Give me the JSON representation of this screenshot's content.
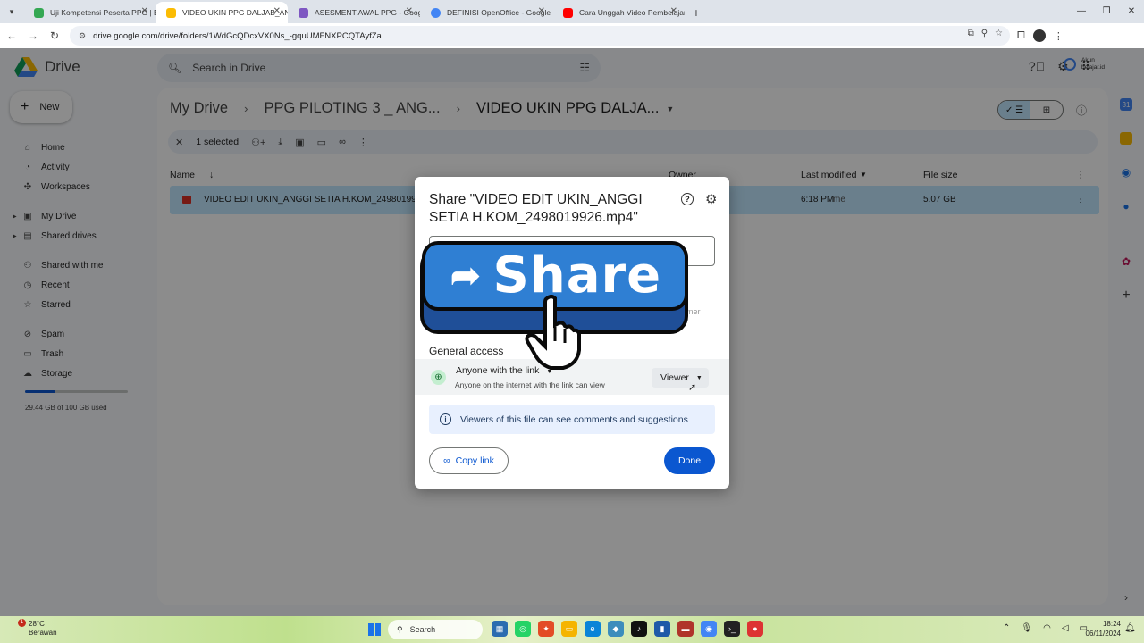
{
  "browser": {
    "tabs": [
      {
        "label": "Uji Kompetensi Peserta PPG | Bi",
        "color": "#34a853",
        "active": false
      },
      {
        "label": "VIDEO UKIN PPG DALJAB_ANGGI",
        "color": "#fbbc04",
        "active": true
      },
      {
        "label": "ASESMENT AWAL PPG - Google",
        "color": "#7e57c2",
        "active": false
      },
      {
        "label": "DEFINISI OpenOffice - Google",
        "color": "#4285f4",
        "active": false
      },
      {
        "label": "Cara Unggah Video Pembelajar",
        "color": "#ff0000",
        "active": false
      }
    ],
    "url": "drive.google.com/drive/folders/1WdGcQDcxVX0Ns_-gquUMFNXPCQTAyfZa"
  },
  "drive": {
    "app_name": "Drive",
    "search_placeholder": "Search in Drive",
    "account_org": "Akun belajar.id",
    "new_label": "New",
    "sidebar": {
      "items": [
        {
          "label": "Home",
          "icon": "home-icon",
          "glyph": "⌂"
        },
        {
          "label": "Activity",
          "icon": "activity-icon",
          "glyph": "⍙"
        },
        {
          "label": "Workspaces",
          "icon": "workspaces-icon",
          "glyph": "✣"
        },
        {
          "label": "My Drive",
          "icon": "my-drive-icon",
          "glyph": "▣"
        },
        {
          "label": "Shared drives",
          "icon": "shared-drives-icon",
          "glyph": "▤"
        },
        {
          "label": "Shared with me",
          "icon": "shared-with-me-icon",
          "glyph": "⚇"
        },
        {
          "label": "Recent",
          "icon": "recent-icon",
          "glyph": "◷"
        },
        {
          "label": "Starred",
          "icon": "star-icon",
          "glyph": "☆"
        },
        {
          "label": "Spam",
          "icon": "spam-icon",
          "glyph": "⊘"
        },
        {
          "label": "Trash",
          "icon": "trash-icon",
          "glyph": "🗑"
        },
        {
          "label": "Storage",
          "icon": "cloud-icon",
          "glyph": "☁"
        }
      ],
      "storage_used_fraction": 0.2944,
      "storage_text": "29.44 GB of 100 GB used"
    },
    "breadcrumb": [
      "My Drive",
      "PPG PILOTING 3 _ ANG...",
      "VIDEO UKIN PPG DALJA..."
    ],
    "selection": {
      "count_label": "1 selected"
    },
    "columns": {
      "name": "Name",
      "owner": "Owner",
      "last_modified": "Last modified",
      "file_size": "File size"
    },
    "row": {
      "name": "VIDEO EDIT UKIN_ANGGI SETIA H.KOM_2498019926",
      "modified": "6:18 PM",
      "modified_by": "me",
      "size": "5.07 GB"
    }
  },
  "dialog": {
    "title": "Share \"VIDEO EDIT UKIN_ANGGI SETIA H.KOM_2498019926.mp4\"",
    "owner_hint": "wner",
    "general_access_label": "General access",
    "access_who": "Anyone with the link",
    "access_desc": "Anyone on the internet with the link can view",
    "role": "Viewer",
    "info_text": "Viewers of this file can see comments and suggestions",
    "copy_link_label": "Copy link",
    "done_label": "Done"
  },
  "sticker": {
    "word": "Share"
  },
  "taskbar": {
    "temperature": "28°C",
    "weather": "Berawan",
    "weather_badge": "1",
    "search_label": "Search",
    "time": "18:24",
    "date": "06/11/2024"
  },
  "colors": {
    "accent": "#0b57d0",
    "selected_row": "#c2e7ff",
    "sticker_blue": "#2f7fd3"
  }
}
